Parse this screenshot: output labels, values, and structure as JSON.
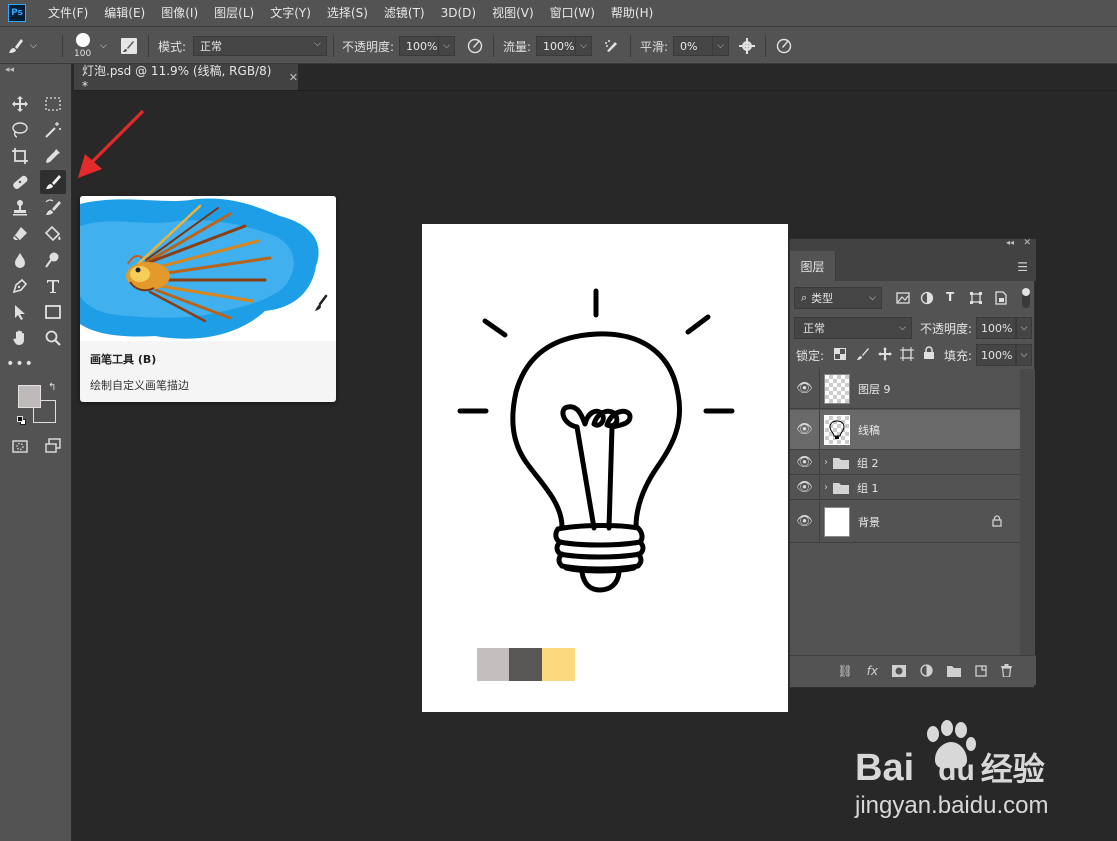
{
  "app": {
    "logo": "Ps"
  },
  "menu": [
    "文件(F)",
    "编辑(E)",
    "图像(I)",
    "图层(L)",
    "文字(Y)",
    "选择(S)",
    "滤镜(T)",
    "3D(D)",
    "视图(V)",
    "窗口(W)",
    "帮助(H)"
  ],
  "options": {
    "brush_size": "100",
    "mode_label": "模式:",
    "mode_value": "正常",
    "opacity_label": "不透明度:",
    "opacity_value": "100%",
    "flow_label": "流量:",
    "flow_value": "100%",
    "smooth_label": "平滑:",
    "smooth_value": "0%"
  },
  "document": {
    "tab_title": "灯泡.psd @ 11.9% (线稿, RGB/8) *"
  },
  "tooltip": {
    "title": "画笔工具 (B)",
    "description": "绘制自定义画笔描边"
  },
  "canvas": {
    "swatches": [
      "#c4bfbf",
      "#595656",
      "#fcd97e"
    ]
  },
  "toolbox": {
    "foreground_color": "#bfbaba",
    "background_color": "#535353",
    "active_tool": "brush-tool"
  },
  "layers_panel": {
    "tab": "图层",
    "filter_label": "类型",
    "blend_mode": "正常",
    "opacity_label": "不透明度:",
    "opacity_value": "100%",
    "lock_label": "锁定:",
    "fill_label": "填充:",
    "fill_value": "100%",
    "layers": [
      {
        "name": "图层 9",
        "type": "layer"
      },
      {
        "name": "线稿",
        "type": "layer",
        "selected": true
      },
      {
        "name": "组 2",
        "type": "group"
      },
      {
        "name": "组 1",
        "type": "group"
      },
      {
        "name": "背景",
        "type": "background",
        "locked": true
      }
    ]
  },
  "watermark": {
    "brand": "Bai",
    "brand_du": "du",
    "brand_cn": "经验",
    "url": "jingyan.baidu.com"
  }
}
